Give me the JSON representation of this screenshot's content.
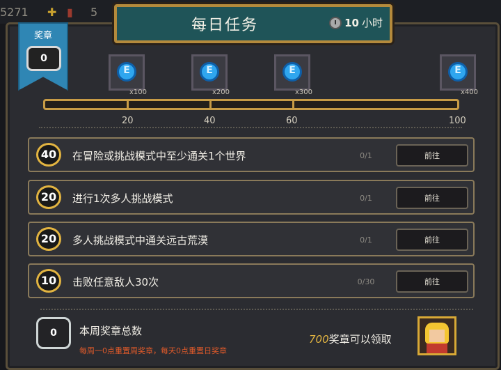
{
  "topbar": {
    "left_text": "5271",
    "left_icon": "plus-icon",
    "item_icon": "card-icon",
    "item_count": "5"
  },
  "title": "每日任务",
  "timer": {
    "value": "10",
    "unit": "小时"
  },
  "badge": {
    "label": "奖章",
    "count": "0"
  },
  "rewards": [
    {
      "qty": "x100",
      "icon": "gem-icon"
    },
    {
      "qty": "x200",
      "icon": "gem-icon"
    },
    {
      "qty": "x300",
      "icon": "gem-icon"
    },
    {
      "qty": "x400",
      "icon": "gem-icon"
    }
  ],
  "milestones": [
    "20",
    "40",
    "60",
    "100"
  ],
  "progress_fraction": 0,
  "tasks": [
    {
      "points": "40",
      "desc": "在冒险或挑战模式中至少通关1个世界",
      "progress": "0/1",
      "button": "前往"
    },
    {
      "points": "20",
      "desc": "进行1次多人挑战模式",
      "progress": "0/1",
      "button": "前往"
    },
    {
      "points": "20",
      "desc": "多人挑战模式中通关远古荒漠",
      "progress": "0/1",
      "button": "前往"
    },
    {
      "points": "10",
      "desc": "击败任意敌人30次",
      "progress": "0/30",
      "button": "前往"
    }
  ],
  "weekly": {
    "count": "0",
    "label": "本周奖章总数",
    "note": "每周一0点重置周奖章，每天0点重置日奖章"
  },
  "claim": {
    "amount": "700",
    "text": "奖章可以领取"
  },
  "colors": {
    "accent_gold": "#e2b441",
    "title_teal": "#1f5458",
    "note_red": "#e05a2a"
  }
}
